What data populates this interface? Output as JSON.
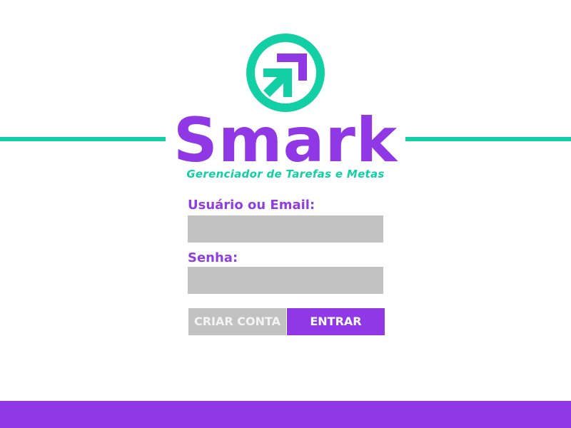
{
  "brand": {
    "name": "Smark",
    "tagline": "Gerenciador de Tarefas e Metas"
  },
  "login_form": {
    "user_label": "Usuário ou Email:",
    "user_value": "",
    "password_label": "Senha:",
    "password_value": "",
    "create_account_label": "CRIAR CONTA",
    "enter_label": "ENTRAR"
  },
  "icons": {
    "logo": "up-right-arrow-in-circle-icon"
  },
  "colors": {
    "primary_purple": "#9038e6",
    "accent_teal": "#12cfa5",
    "input_gray": "#c2c2c2",
    "background": "#ffffff"
  }
}
